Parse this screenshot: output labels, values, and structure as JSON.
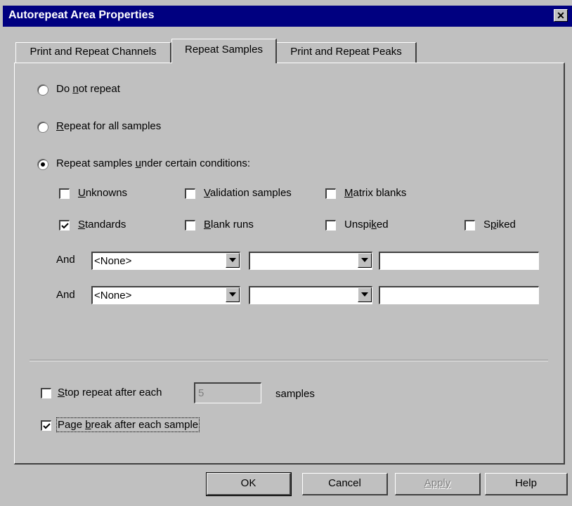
{
  "window": {
    "title": "Autorepeat Area Properties",
    "close_label": "✕"
  },
  "tabs": [
    {
      "label": "Print and Repeat Channels",
      "selected": false
    },
    {
      "label": "Repeat Samples",
      "selected": true
    },
    {
      "label": "Print and Repeat Peaks",
      "selected": false
    }
  ],
  "repeat_mode": {
    "options": [
      {
        "label": "Do not repeat",
        "selected": false
      },
      {
        "label": "Repeat for all samples",
        "selected": false
      },
      {
        "label": "Repeat samples under certain conditions:",
        "selected": true
      }
    ]
  },
  "conditions": {
    "unknowns": {
      "label": "Unknowns",
      "checked": false
    },
    "validation_samples": {
      "label": "Validation samples",
      "checked": false
    },
    "matrix_blanks": {
      "label": "Matrix blanks",
      "checked": false
    },
    "standards": {
      "label": "Standards",
      "checked": true
    },
    "blank_runs": {
      "label": "Blank runs",
      "checked": false
    },
    "unspiked": {
      "label": "Unspiked",
      "checked": false
    },
    "spiked": {
      "label": "Spiked",
      "checked": false
    }
  },
  "and_rows": [
    {
      "label": "And",
      "field": "<None>",
      "operator": "",
      "value": ""
    },
    {
      "label": "And",
      "field": "<None>",
      "operator": "",
      "value": ""
    }
  ],
  "stop_repeat": {
    "label": "Stop repeat after each",
    "checked": false,
    "value": "5",
    "suffix": "samples"
  },
  "page_break": {
    "label": "Page break after each sample",
    "checked": true
  },
  "buttons": {
    "ok": "OK",
    "cancel": "Cancel",
    "apply": "Apply",
    "help": "Help"
  }
}
